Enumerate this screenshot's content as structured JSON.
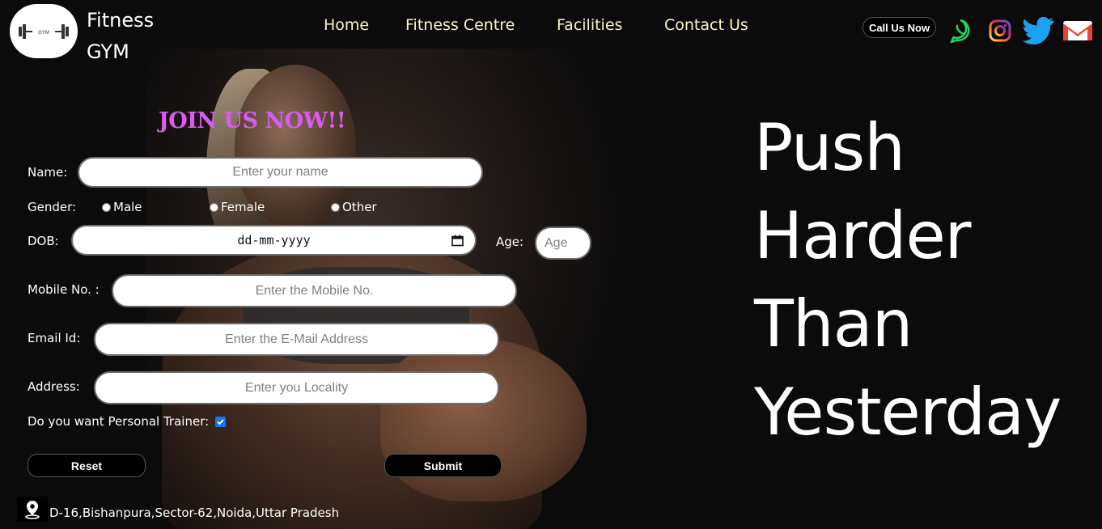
{
  "brand": {
    "line1": "Fitness",
    "line2": "GYM",
    "logo_text": "GYM"
  },
  "nav": {
    "items": [
      "Home",
      "Fitness Centre",
      "Facilities",
      "Contact Us"
    ]
  },
  "header_actions": {
    "call_label": "Call Us Now"
  },
  "social_icons": [
    "whatsapp-icon",
    "instagram-icon",
    "twitter-icon",
    "gmail-icon"
  ],
  "colors": {
    "title": "#d95bf0",
    "nav": "#fff3c8",
    "checkbox": "#1a73e8"
  },
  "form": {
    "title": "JOIN US NOW!!",
    "name_label": "Name:",
    "name_placeholder": "Enter your name",
    "gender_label": "Gender:",
    "gender_options": [
      "Male",
      "Female",
      "Other"
    ],
    "dob_label": "DOB:",
    "dob_placeholder": "dd-mm-yyyy",
    "age_label": "Age:",
    "age_placeholder": "Age",
    "mobile_label": "Mobile No. :",
    "mobile_placeholder": "Enter the Mobile No.",
    "email_label": "Email Id:",
    "email_placeholder": "Enter the E-Mail Address",
    "address_label": "Address:",
    "address_placeholder": "Enter you Locality",
    "trainer_label": "Do you want Personal Trainer:",
    "trainer_checked": true,
    "reset_label": "Reset",
    "submit_label": "Submit"
  },
  "footer": {
    "address": "D-16,Bishanpura,Sector-62,Noida,Uttar Pradesh"
  },
  "tagline": {
    "lines": [
      "Push",
      "Harder",
      "Than",
      "Yesterday"
    ]
  }
}
